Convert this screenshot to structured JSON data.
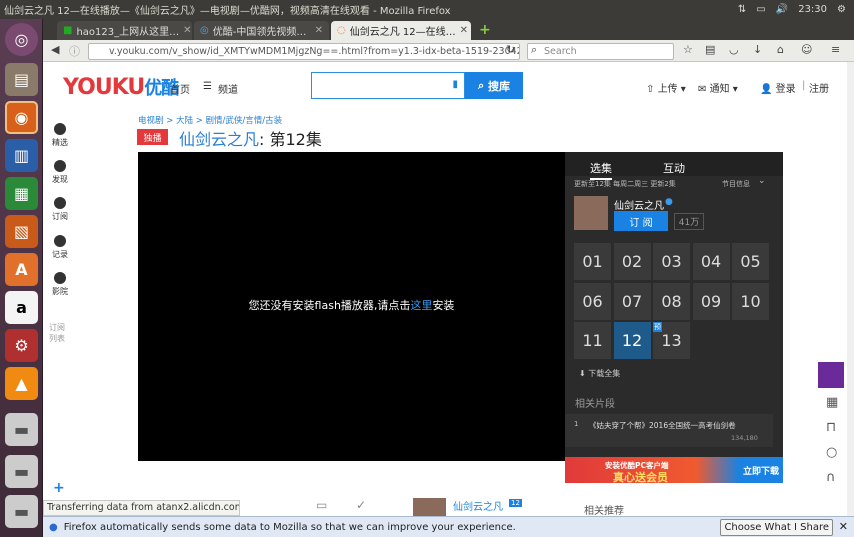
{
  "window": {
    "title": "仙剑云之凡 12—在线播放—《仙剑云之凡》—电视剧—优酷网，视频高清在线观看 - Mozilla Firefox",
    "time": "23:30"
  },
  "tabs": [
    {
      "label": "hao123_上网从这里…"
    },
    {
      "label": "优酷-中国领先视频…"
    },
    {
      "label": "仙剑云之凡 12—在线…"
    }
  ],
  "nav": {
    "url": "v.youku.com/v_show/id_XMTYwMDM1MjgzNg==.html?from=y1.3-idx-beta-1519-23042.2",
    "search_placeholder": "Search"
  },
  "youku": {
    "logo_en": "YOUKU",
    "logo_cn": "优酷",
    "nav_home": "首页",
    "nav_channel": "频道",
    "search_btn": "搜库",
    "upload": "上传",
    "notify": "通知",
    "login": "登录",
    "sep": "|",
    "register": "注册"
  },
  "sidenav": [
    {
      "label": "精选"
    },
    {
      "label": "发现"
    },
    {
      "label": "订阅"
    },
    {
      "label": "记录"
    },
    {
      "label": "影院"
    },
    {
      "label": "订阅列表"
    }
  ],
  "crumb": "电视剧 > 大陆 > 剧情/武侠/言情/古装",
  "badge": "独播",
  "title": "仙剑云之凡",
  "title_ep": "第12集",
  "flash_msg_pre": "您还没有安装flash播放器,请点击",
  "flash_link": "这里",
  "flash_msg_post": "安装",
  "panel": {
    "tab1": "选集",
    "tab2": "互动",
    "update": "更新至12集 每周二周三 更新2集",
    "info": "节目信息",
    "channel": "仙剑云之凡",
    "subscribe": "订 阅",
    "subs": "41万",
    "episodes": [
      "01",
      "02",
      "03",
      "04",
      "05",
      "06",
      "07",
      "08",
      "09",
      "10",
      "11",
      "12",
      "13"
    ],
    "new_tag": "预",
    "download": "下载全集",
    "related": "相关片段",
    "clip_num": "1",
    "clip": "《姑夫穿了个帮》2016全国统一高考仙剑卷",
    "clip_views": "134,180"
  },
  "promo": {
    "text1": "安装优酷PC客户端",
    "text2": "真心送会员",
    "btn": "立即下载"
  },
  "bottom": {
    "channel": "仙剑云之凡",
    "badge": "12",
    "related": "相关推荐"
  },
  "status": "Transferring data from atanx2.alicdn.com…",
  "notification": {
    "text": "Firefox automatically sends some data to Mozilla so that we can improve your experience.",
    "button": "Choose What I Share",
    "close": "✕"
  },
  "colors": {
    "accent": "#1a82e2",
    "red": "#e4393c"
  }
}
